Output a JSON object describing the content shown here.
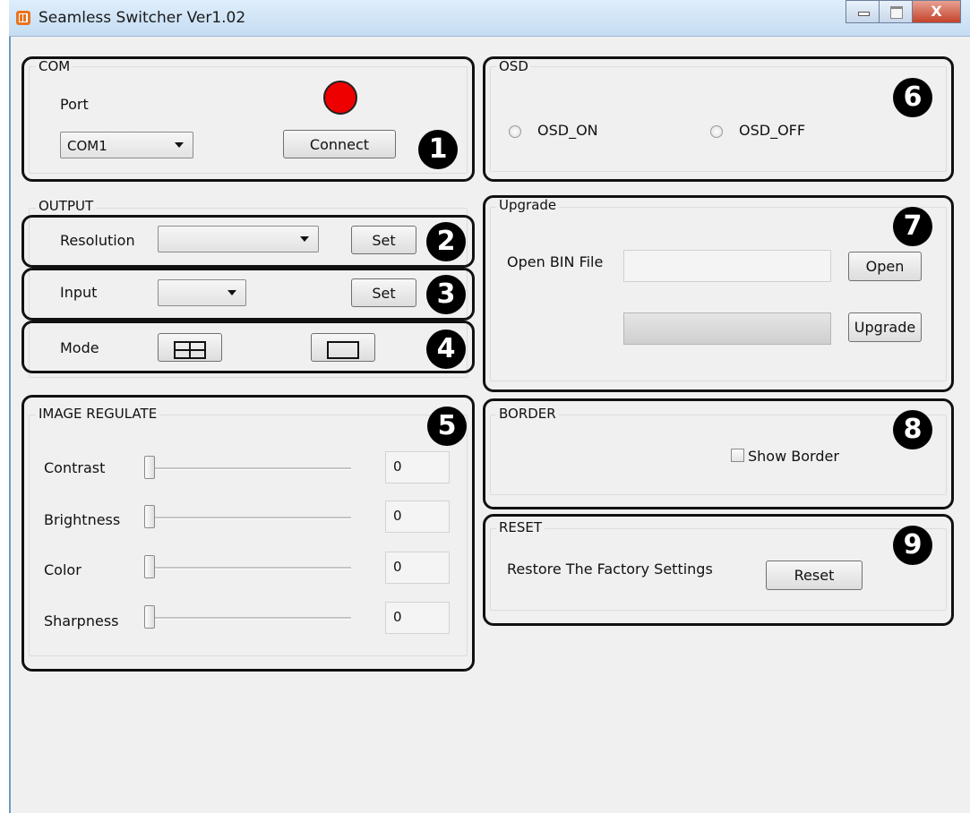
{
  "window": {
    "title": "Seamless Switcher Ver1.02",
    "close_label": "X"
  },
  "com": {
    "group_label": "COM",
    "port_label": "Port",
    "port_value": "COM1",
    "connect_label": "Connect",
    "status_led_color": "#ee0000",
    "badge": "1"
  },
  "output": {
    "group_label": "OUTPUT",
    "resolution": {
      "label": "Resolution",
      "value": "",
      "set_label": "Set",
      "badge": "2"
    },
    "input": {
      "label": "Input",
      "value": "",
      "set_label": "Set",
      "badge": "3"
    },
    "mode": {
      "label": "Mode",
      "options": [
        "quad-split-icon",
        "single-screen-icon"
      ],
      "badge": "4"
    }
  },
  "image_regulate": {
    "group_label": "IMAGE REGULATE",
    "badge": "5",
    "sliders": [
      {
        "label": "Contrast",
        "value": "0"
      },
      {
        "label": "Brightness",
        "value": "0"
      },
      {
        "label": "Color",
        "value": "0"
      },
      {
        "label": "Sharpness",
        "value": "0"
      }
    ]
  },
  "osd": {
    "group_label": "OSD",
    "on_label": "OSD_ON",
    "off_label": "OSD_OFF",
    "badge": "6"
  },
  "upgrade": {
    "group_label": "Upgrade",
    "open_bin_label": "Open BIN File",
    "file_path": "",
    "open_label": "Open",
    "upgrade_label": "Upgrade",
    "progress": 0,
    "badge": "7"
  },
  "border": {
    "group_label": "BORDER",
    "show_border_label": "Show Border",
    "show_border_checked": false,
    "badge": "8"
  },
  "reset": {
    "group_label": "RESET",
    "restore_label": "Restore The Factory Settings",
    "reset_label": "Reset",
    "badge": "9"
  }
}
